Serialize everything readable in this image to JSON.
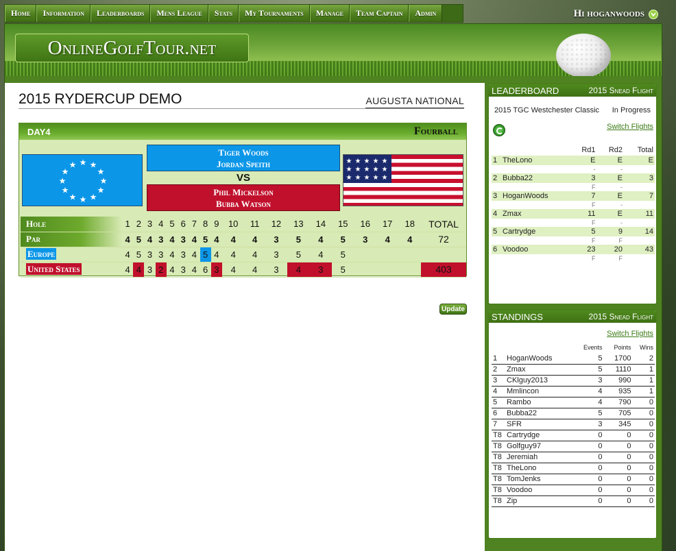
{
  "nav": {
    "items": [
      "Home",
      "Information",
      "Leaderboards",
      "Mens League",
      "Stats",
      "My Tournaments",
      "Manage",
      "Team Captain",
      "Admin"
    ],
    "user_greeting": "Hi hoganwoods"
  },
  "site": {
    "logo_text": "OnlineGolfTour.net"
  },
  "event": {
    "title": "2015 RYDERCUP DEMO",
    "course": "AUGUSTA NATIONAL"
  },
  "match": {
    "day": "DAY4",
    "format": "Fourball",
    "europe_players": [
      "Tiger Woods",
      "Jordan Speith"
    ],
    "vs": "VS",
    "us_players": [
      "Phil Mickelson",
      "Bubba Watson"
    ],
    "row_labels": {
      "hole": "Hole",
      "par": "Par",
      "europe": "Europe",
      "us": "United States"
    },
    "total_label": "TOTAL",
    "holes": [
      1,
      2,
      3,
      4,
      5,
      6,
      7,
      8,
      9,
      10,
      11,
      12,
      13,
      14,
      15,
      16,
      17,
      18
    ],
    "par": [
      4,
      5,
      4,
      3,
      4,
      3,
      4,
      5,
      4,
      4,
      4,
      3,
      5,
      4,
      5,
      3,
      4,
      4
    ],
    "par_total": "72",
    "europe_scores": [
      4,
      5,
      3,
      3,
      4,
      3,
      4,
      5,
      4,
      4,
      4,
      3,
      5,
      4,
      5,
      "",
      "",
      ""
    ],
    "europe_total": "",
    "us_scores": [
      4,
      4,
      3,
      2,
      4,
      3,
      4,
      6,
      3,
      4,
      4,
      3,
      4,
      3,
      5,
      "",
      "",
      ""
    ],
    "us_total": "403",
    "europe_win_holes": [
      8
    ],
    "us_win_holes": [
      2,
      4,
      9,
      13,
      14
    ],
    "update_label": "Update",
    "colors": {
      "europe": "#0b96e8",
      "us": "#c0102c"
    }
  },
  "leaderboard": {
    "title": "LEADERBOARD",
    "flight": "2015 Snead Flight",
    "event": "2015 TGC Westchester Classic",
    "status": "In Progress",
    "switch_label": "Switch Flights",
    "columns": [
      "Rd1",
      "Rd2",
      "Total"
    ],
    "rows": [
      {
        "pos": "1",
        "name": "TheLono",
        "rd1": "E",
        "rd2": "E",
        "total": "E",
        "sub1": "-",
        "sub2": "-"
      },
      {
        "pos": "2",
        "name": "Bubba22",
        "rd1": "3",
        "rd2": "E",
        "total": "3",
        "sub1": "F",
        "sub2": "-"
      },
      {
        "pos": "3",
        "name": "HoganWoods",
        "rd1": "7",
        "rd2": "E",
        "total": "7",
        "sub1": "F",
        "sub2": "-"
      },
      {
        "pos": "4",
        "name": "Zmax",
        "rd1": "11",
        "rd2": "E",
        "total": "11",
        "sub1": "F",
        "sub2": "-"
      },
      {
        "pos": "5",
        "name": "Cartrydge",
        "rd1": "5",
        "rd2": "9",
        "total": "14",
        "sub1": "F",
        "sub2": "F"
      },
      {
        "pos": "6",
        "name": "Voodoo",
        "rd1": "23",
        "rd2": "20",
        "total": "43",
        "sub1": "F",
        "sub2": "F"
      }
    ]
  },
  "standings": {
    "title": "STANDINGS",
    "flight": "2015 Snead Flight",
    "switch_label": "Switch Flights",
    "columns": [
      "Events",
      "Points",
      "Wins"
    ],
    "rows": [
      {
        "pos": "1",
        "name": "HoganWoods",
        "events": "5",
        "points": "1700",
        "wins": "2"
      },
      {
        "pos": "2",
        "name": "Zmax",
        "events": "5",
        "points": "1110",
        "wins": "1"
      },
      {
        "pos": "3",
        "name": "CKlguy2013",
        "events": "3",
        "points": "990",
        "wins": "1"
      },
      {
        "pos": "4",
        "name": "Mmlincon",
        "events": "4",
        "points": "935",
        "wins": "1"
      },
      {
        "pos": "5",
        "name": "Rambo",
        "events": "4",
        "points": "790",
        "wins": "0"
      },
      {
        "pos": "6",
        "name": "Bubba22",
        "events": "5",
        "points": "705",
        "wins": "0"
      },
      {
        "pos": "7",
        "name": "SFR",
        "events": "3",
        "points": "345",
        "wins": "0"
      },
      {
        "pos": "T8",
        "name": "Cartrydge",
        "events": "0",
        "points": "0",
        "wins": "0"
      },
      {
        "pos": "T8",
        "name": "Golfguy97",
        "events": "0",
        "points": "0",
        "wins": "0"
      },
      {
        "pos": "T8",
        "name": "Jeremiah",
        "events": "0",
        "points": "0",
        "wins": "0"
      },
      {
        "pos": "T8",
        "name": "TheLono",
        "events": "0",
        "points": "0",
        "wins": "0"
      },
      {
        "pos": "T8",
        "name": "TomJenks",
        "events": "0",
        "points": "0",
        "wins": "0"
      },
      {
        "pos": "T8",
        "name": "Voodoo",
        "events": "0",
        "points": "0",
        "wins": "0"
      },
      {
        "pos": "T8",
        "name": "Zip",
        "events": "0",
        "points": "0",
        "wins": "0"
      }
    ]
  }
}
